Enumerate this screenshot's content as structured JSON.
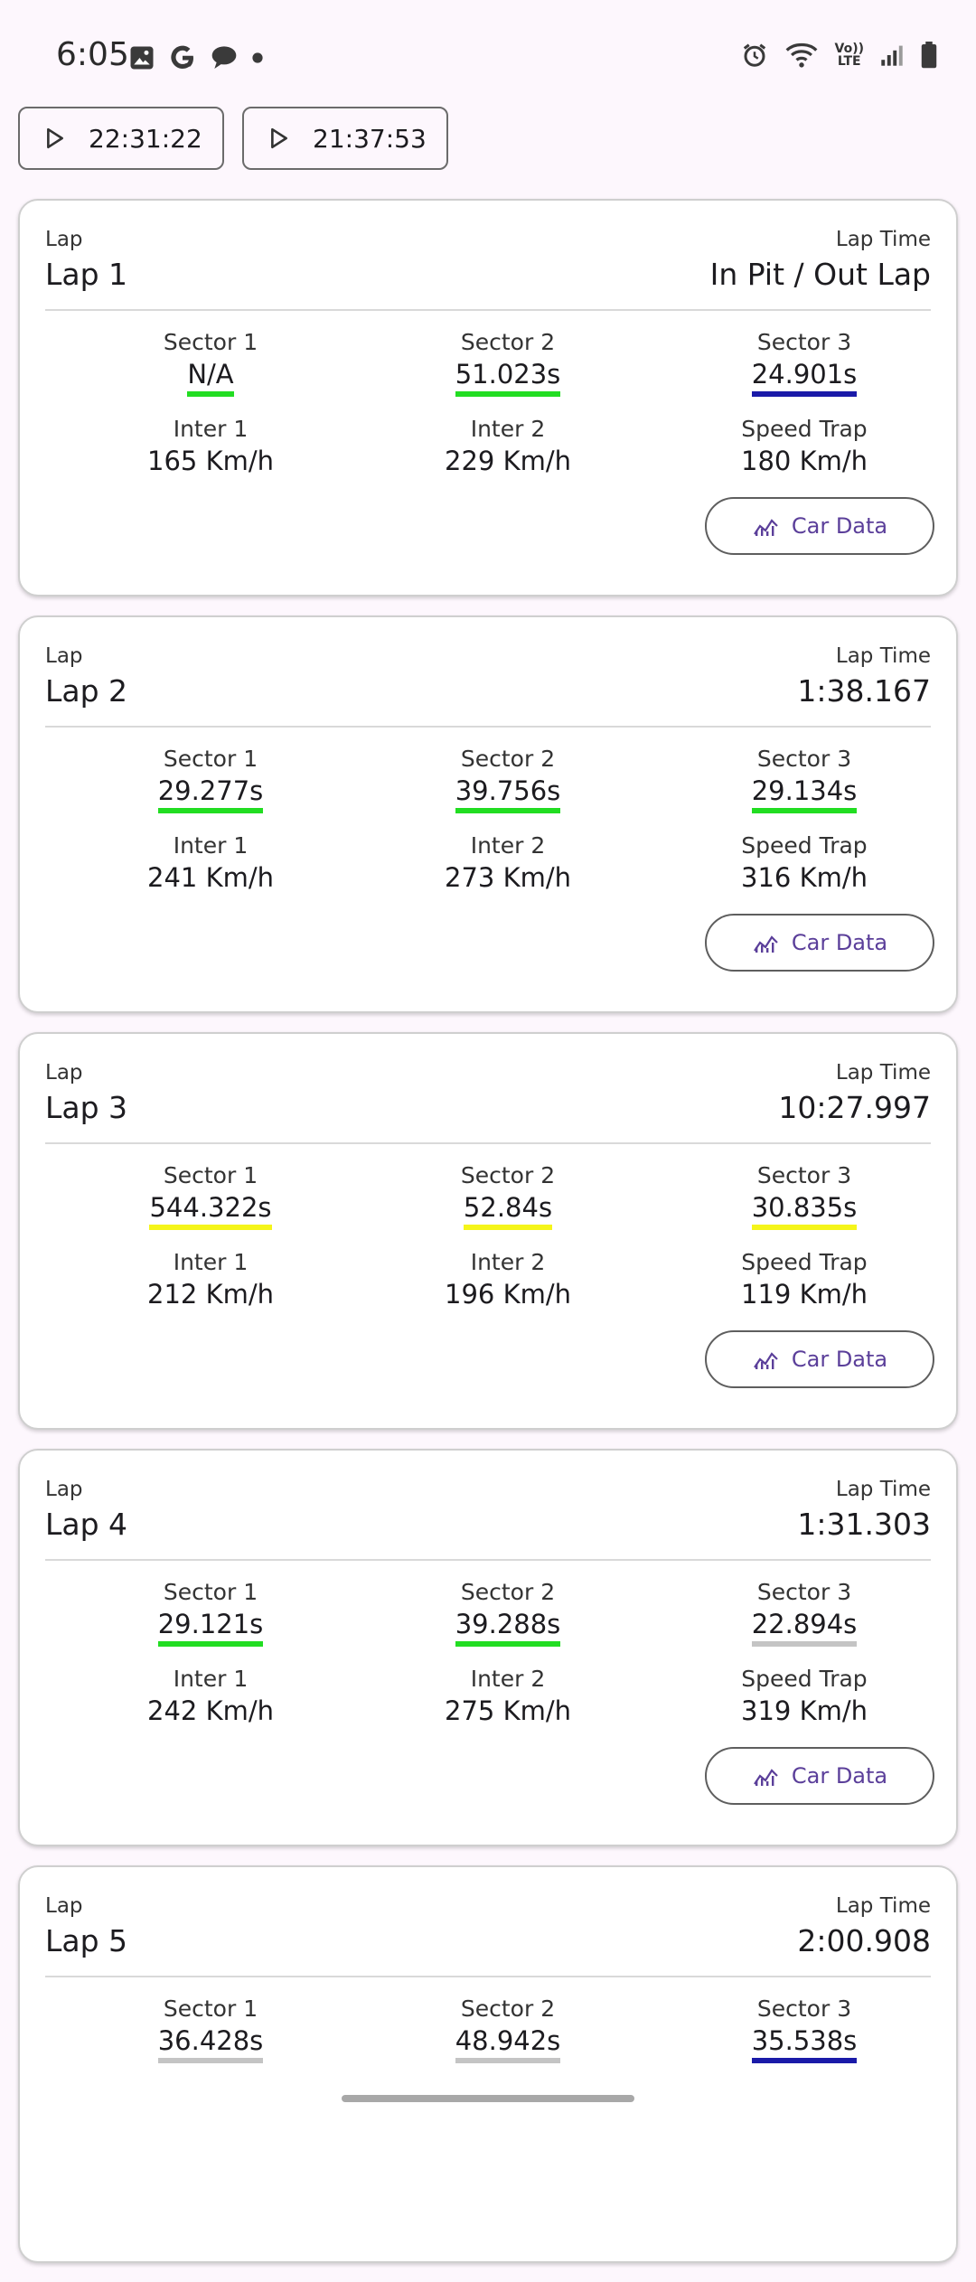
{
  "status": {
    "time": "6:05",
    "volte": [
      "Vo))",
      "LTE"
    ]
  },
  "sessions": [
    {
      "label": "22:31:22"
    },
    {
      "label": "21:37:53"
    }
  ],
  "labels": {
    "lap": "Lap",
    "lap_time": "Lap Time",
    "sector1": "Sector 1",
    "sector2": "Sector 2",
    "sector3": "Sector 3",
    "inter1": "Inter 1",
    "inter2": "Inter 2",
    "speed_trap": "Speed Trap",
    "car_data": "Car Data"
  },
  "colors": {
    "green": "#22dd22",
    "blue": "#1a1aa8",
    "yellow": "#f5f51a",
    "gray": "#c4c4c4",
    "accent": "#5b3f9a"
  },
  "laps": [
    {
      "name": "Lap 1",
      "time": "In Pit / Out Lap",
      "sectors": [
        {
          "value": "N/A",
          "color": "green"
        },
        {
          "value": "51.023s",
          "color": "green"
        },
        {
          "value": "24.901s",
          "color": "blue"
        }
      ],
      "inter1": "165 Km/h",
      "inter2": "229 Km/h",
      "speed_trap": "180 Km/h"
    },
    {
      "name": "Lap 2",
      "time": "1:38.167",
      "sectors": [
        {
          "value": "29.277s",
          "color": "green"
        },
        {
          "value": "39.756s",
          "color": "green"
        },
        {
          "value": "29.134s",
          "color": "green"
        }
      ],
      "inter1": "241 Km/h",
      "inter2": "273 Km/h",
      "speed_trap": "316 Km/h"
    },
    {
      "name": "Lap 3",
      "time": "10:27.997",
      "sectors": [
        {
          "value": "544.322s",
          "color": "yellow"
        },
        {
          "value": "52.84s",
          "color": "yellow"
        },
        {
          "value": "30.835s",
          "color": "yellow"
        }
      ],
      "inter1": "212 Km/h",
      "inter2": "196 Km/h",
      "speed_trap": "119 Km/h"
    },
    {
      "name": "Lap 4",
      "time": "1:31.303",
      "sectors": [
        {
          "value": "29.121s",
          "color": "green"
        },
        {
          "value": "39.288s",
          "color": "green"
        },
        {
          "value": "22.894s",
          "color": "gray"
        }
      ],
      "inter1": "242 Km/h",
      "inter2": "275 Km/h",
      "speed_trap": "319 Km/h"
    },
    {
      "name": "Lap 5",
      "time": "2:00.908",
      "sectors": [
        {
          "value": "36.428s",
          "color": "gray"
        },
        {
          "value": "48.942s",
          "color": "gray"
        },
        {
          "value": "35.538s",
          "color": "blue"
        }
      ]
    }
  ]
}
